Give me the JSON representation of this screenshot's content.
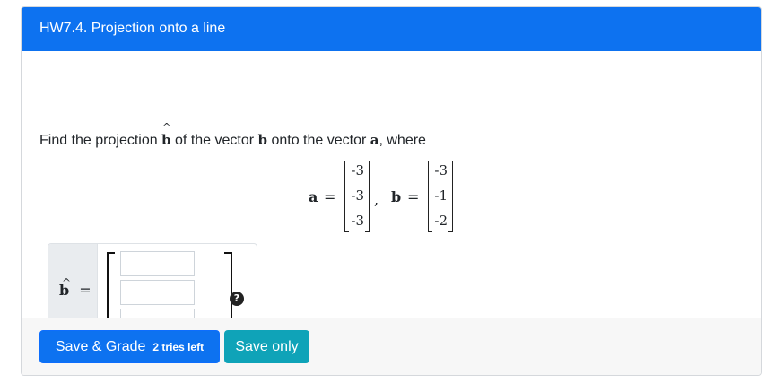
{
  "header": {
    "title": "HW7.4. Projection onto a line"
  },
  "question": {
    "prefix": "Find the projection ",
    "bhat_symbol": "b",
    "mid1": " of the vector ",
    "b_symbol": "b",
    "mid2": " onto the vector ",
    "a_symbol": "a",
    "suffix": ", where"
  },
  "math": {
    "a_label": "a",
    "b_label": "b",
    "equals": "=",
    "comma": ",",
    "a_vector": [
      "-3",
      "-3",
      "-3"
    ],
    "b_vector": [
      "-3",
      "-1",
      "-2"
    ]
  },
  "answer": {
    "label": "b",
    "hat": "^",
    "equals": "=",
    "inputs": [
      "",
      "",
      ""
    ],
    "help_icon": "question-circle-icon",
    "help_glyph": "?"
  },
  "footer": {
    "save_grade_label": "Save & Grade",
    "tries_left": "2 tries left",
    "save_only_label": "Save only"
  },
  "colors": {
    "header_bg": "#0d72f0",
    "primary_button": "#0d72f0",
    "info_button": "#0fa3b8"
  }
}
